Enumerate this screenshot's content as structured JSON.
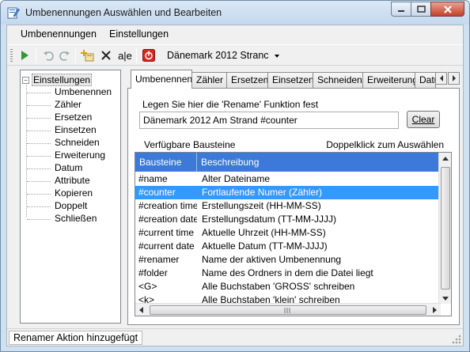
{
  "window": {
    "title": "Umbenennungen Auswählen und Bearbeiten"
  },
  "menu": [
    "Umbenennungen",
    "Einstellungen"
  ],
  "toolbar": {
    "ae_label": "a|e",
    "combo_value": "Dänemark 2012 Stranc"
  },
  "tree": {
    "root": "Einstellungen",
    "items": [
      "Umbenennen",
      "Zähler",
      "Ersetzen",
      "Einsetzen",
      "Schneiden",
      "Erweiterung",
      "Datum",
      "Attribute",
      "Kopieren",
      "Doppelt",
      "Schließen"
    ]
  },
  "tabs": [
    "Umbenennen",
    "Zähler",
    "Ersetzen",
    "Einsetzen",
    "Schneiden",
    "Erweiterung",
    "Datu"
  ],
  "rename": {
    "label": "Legen Sie hier die 'Rename' Funktion fest",
    "value": "Dänemark 2012 Am Strand #counter",
    "clear": "Clear"
  },
  "bausteine": {
    "title": "Verfügbare Bausteine",
    "hint": "Doppelklick zum Auswählen",
    "columns": [
      "Bausteine",
      "Beschreibung"
    ],
    "rows": [
      [
        "#name",
        "Alter Dateiname"
      ],
      [
        "#counter",
        "Fortlaufende Numer (Zähler)"
      ],
      [
        "#creation time",
        "Erstellungszeit (HH-MM-SS)"
      ],
      [
        "#creation date",
        "Erstellungsdatum (TT-MM-JJJJ)"
      ],
      [
        "#current time",
        "Aktuelle Uhrzeit (HH-MM-SS)"
      ],
      [
        "#current date",
        "Aktuelle Datum (TT-MM-JJJJ)"
      ],
      [
        "#renamer",
        "Name der aktiven Umbenennung"
      ],
      [
        "#folder",
        "Name des Ordners in dem die Datei liegt"
      ],
      [
        "<G>",
        "Alle Buchstaben 'GROSS' schreiben"
      ],
      [
        "<k>",
        "Alle Buchstaben 'klein' schreiben"
      ]
    ],
    "selected_index": 1
  },
  "status": "Renamer Aktion hinzugefügt"
}
